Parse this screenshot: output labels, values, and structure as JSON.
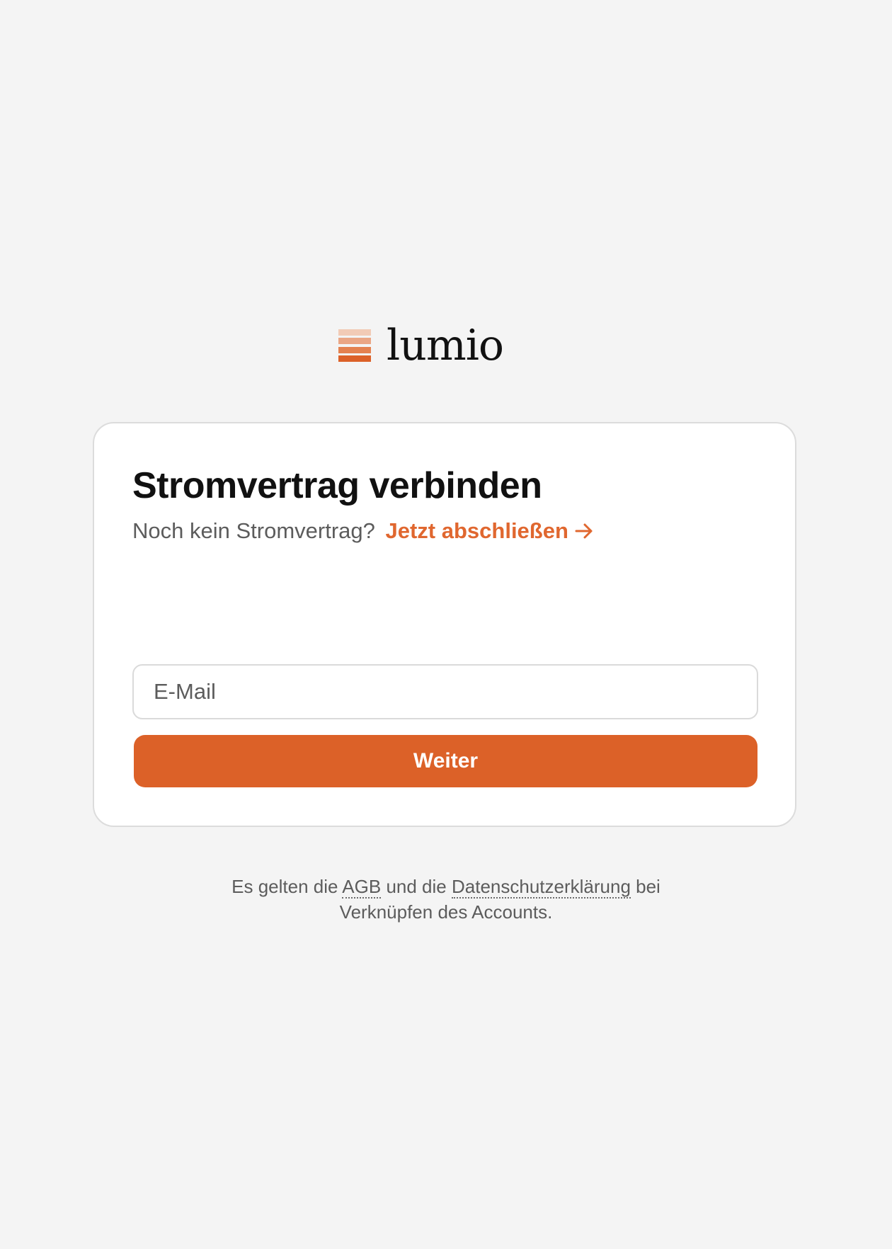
{
  "brand": {
    "name": "lumio",
    "mark_colors": [
      "#f2cbb6",
      "#eaa685",
      "#e4814f",
      "#dc6128"
    ]
  },
  "card": {
    "title": "Stromvertrag verbinden",
    "subtitle_prefix": "Noch kein Stromvertrag?",
    "subtitle_link": "Jetzt abschließen",
    "email_placeholder": "E-Mail",
    "email_value": "",
    "submit_label": "Weiter"
  },
  "legal": {
    "part1": "Es gelten die",
    "agb_link": "AGB",
    "part2": "und die",
    "privacy_link": "Datenschutzerklärung",
    "part3": "bei Verknüpfen des Accounts."
  },
  "colors": {
    "accent": "#dc6128",
    "link": "#e0672f",
    "background": "#f4f4f4"
  }
}
